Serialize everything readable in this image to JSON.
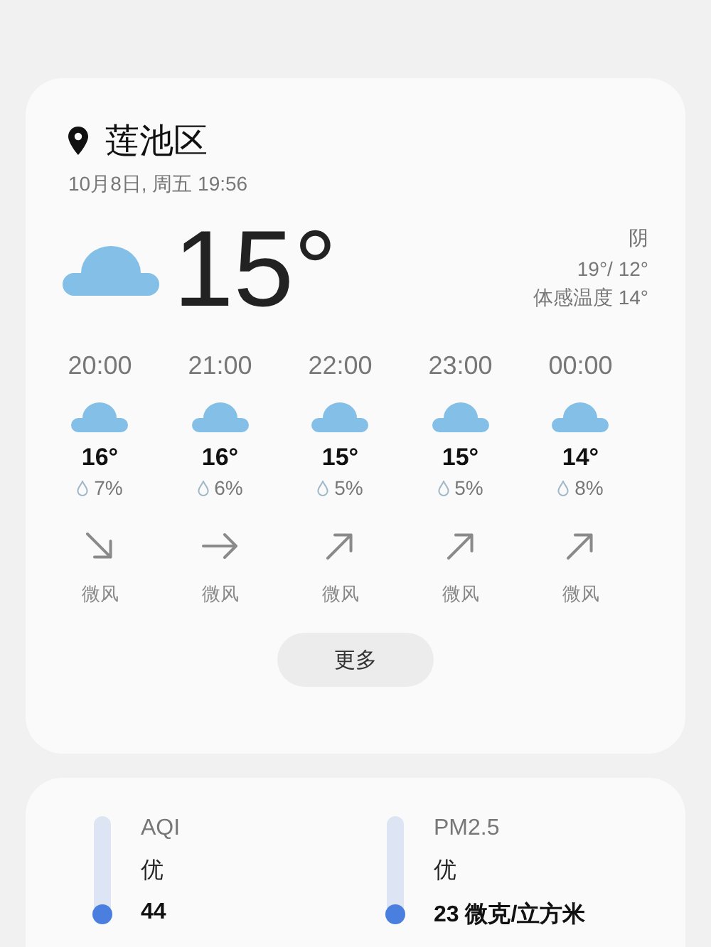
{
  "location": {
    "name": "莲池区",
    "datetime": "10月8日, 周五 19:56"
  },
  "current": {
    "temperature": "15°",
    "condition": "阴",
    "high_low": "19°/ 12°",
    "feels_like": "体感温度 14°"
  },
  "hourly": [
    {
      "time": "20:00",
      "temp": "16°",
      "precip": "7%",
      "kind": "southeast",
      "wind": "微风"
    },
    {
      "time": "21:00",
      "temp": "16°",
      "precip": "6%",
      "kind": "east",
      "wind": "微风"
    },
    {
      "time": "22:00",
      "temp": "15°",
      "precip": "5%",
      "kind": "northeast",
      "wind": "微风"
    },
    {
      "time": "23:00",
      "temp": "15°",
      "precip": "5%",
      "kind": "northeast",
      "wind": "微风"
    },
    {
      "time": "00:00",
      "temp": "14°",
      "precip": "8%",
      "kind": "northeast",
      "wind": "微风"
    }
  ],
  "more_button": "更多",
  "air": [
    {
      "label": "AQI",
      "grade": "优",
      "value": "44",
      "level": 0.05
    },
    {
      "label": "PM2.5",
      "grade": "优",
      "value": "23 微克/立方米",
      "level": 0.05
    }
  ]
}
